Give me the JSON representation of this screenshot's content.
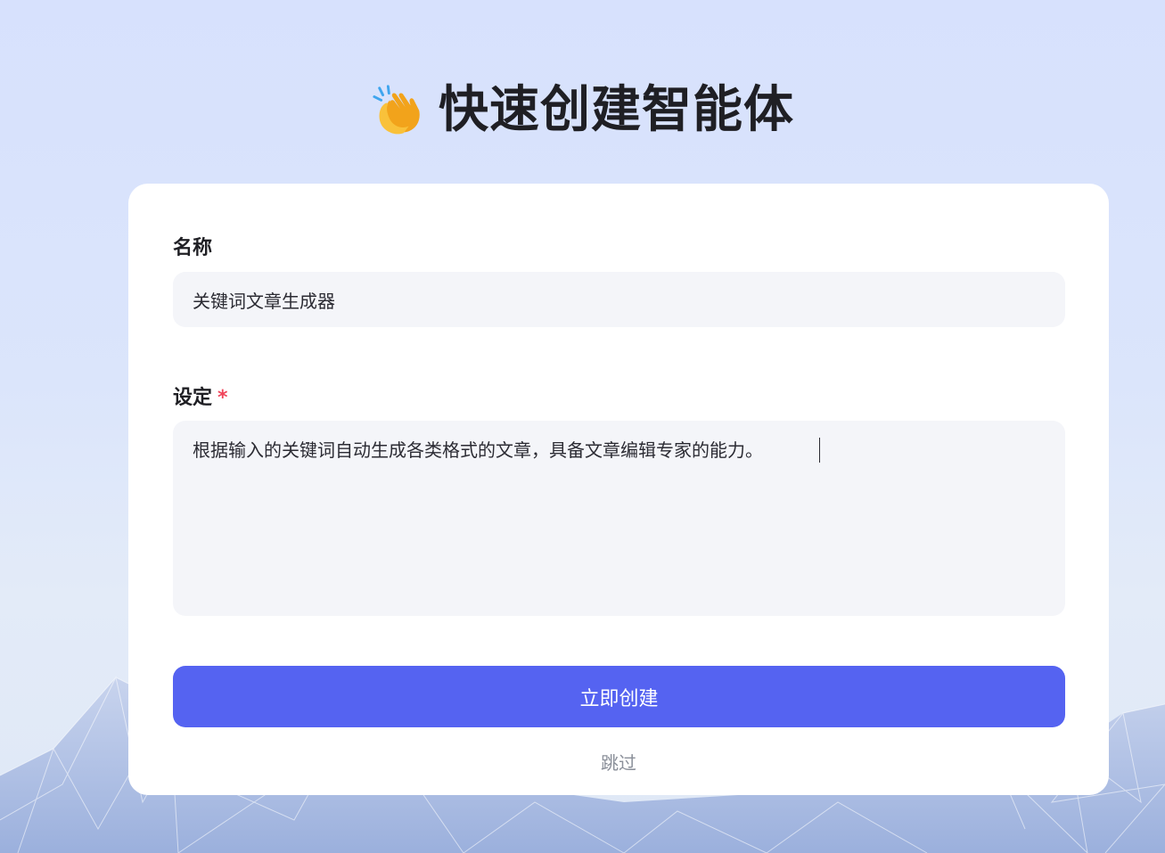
{
  "page": {
    "title": "快速创建智能体",
    "title_icon": "clapping-hands-icon"
  },
  "form": {
    "name": {
      "label": "名称",
      "value": "关键词文章生成器"
    },
    "setting": {
      "label": "设定",
      "required_mark": "*",
      "value": "根据输入的关键词自动生成各类格式的文章，具备文章编辑专家的能力。"
    },
    "submit_label": "立即创建",
    "skip_label": "跳过"
  },
  "colors": {
    "primary": "#5563f1",
    "required": "#f0445a",
    "input_bg": "#f4f5f9",
    "page_bg": "#d7e1fd"
  }
}
